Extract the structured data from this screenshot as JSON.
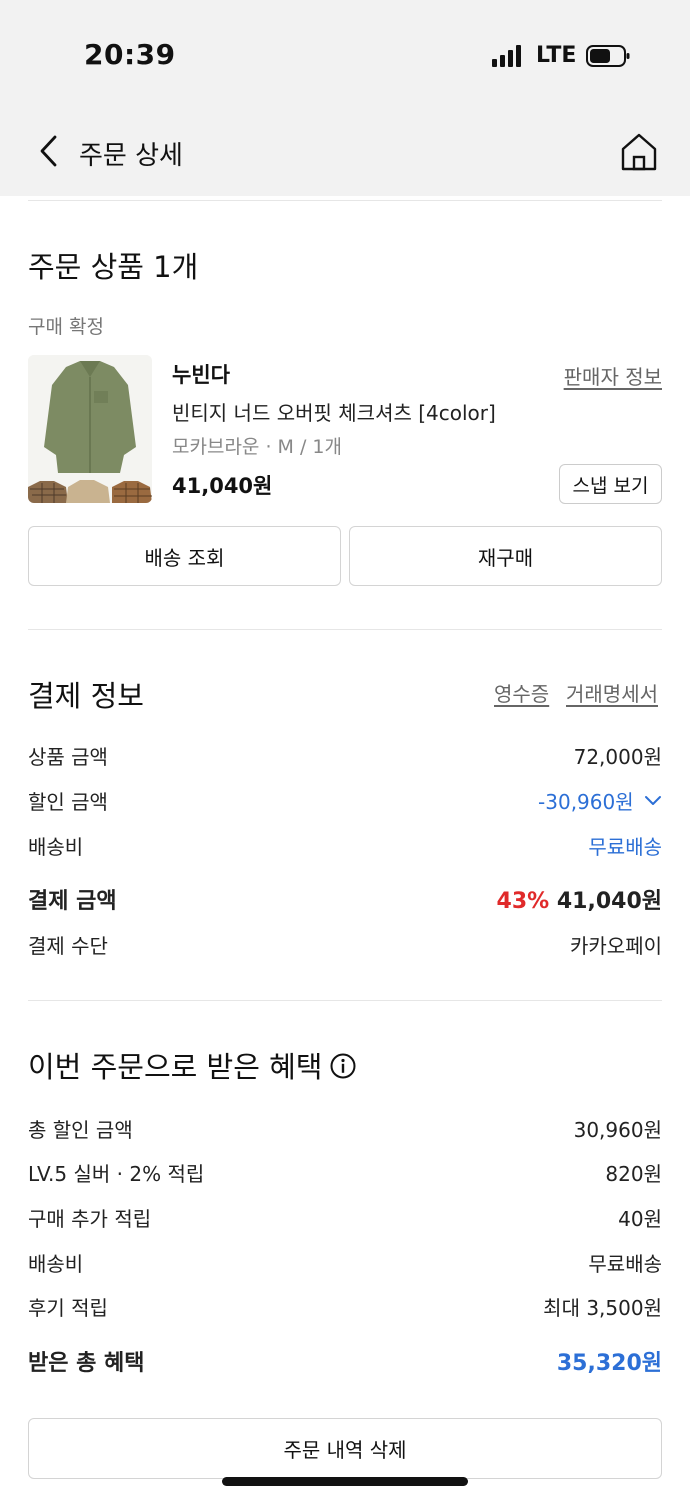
{
  "status_bar": {
    "time": "20:39",
    "network": "LTE"
  },
  "nav": {
    "title": "주문 상세",
    "back_icon": "chevron-left-icon",
    "home_icon": "home-icon"
  },
  "order_items": {
    "title": "주문 상품 1개",
    "status": "구매 확정",
    "product": {
      "brand": "누빈다",
      "seller_info_link": "판매자 정보",
      "name": "빈티지 너드 오버핏 체크셔츠 [4color]",
      "option": "모카브라운 · M / 1개",
      "price": "41,040원",
      "snap_button": "스냅 보기"
    },
    "delivery_button": "배송 조회",
    "reorder_button": "재구매"
  },
  "payment": {
    "title": "결제 정보",
    "receipt_link": "영수증",
    "statement_link": "거래명세서",
    "rows": [
      {
        "label": "상품 금액",
        "value": "72,000원"
      },
      {
        "label": "할인 금액",
        "value": "-30,960원"
      },
      {
        "label": "배송비",
        "value": "무료배송"
      }
    ],
    "total_label": "결제 금액",
    "discount_rate": "43%",
    "total_value": "41,040원",
    "method_label": "결제 수단",
    "method_value": "카카오페이"
  },
  "benefits": {
    "title": "이번 주문으로 받은 혜택",
    "info_icon": "info-icon",
    "rows": [
      {
        "label": "총 할인 금액",
        "value": "30,960원"
      },
      {
        "label": "LV.5 실버 · 2% 적립",
        "value": "820원"
      },
      {
        "label": "구매 추가 적립",
        "value": "40원"
      },
      {
        "label": "배송비",
        "value": "무료배송"
      },
      {
        "label": "후기 적립",
        "value": "최대 3,500원"
      }
    ],
    "total_label": "받은 총 혜택",
    "total_value": "35,320원"
  },
  "delete_button": "주문 내역 삭제",
  "colors": {
    "accent_blue": "#2c6fd6",
    "discount_red": "#e02a2a",
    "topbar_bg": "#f2f2f2"
  }
}
